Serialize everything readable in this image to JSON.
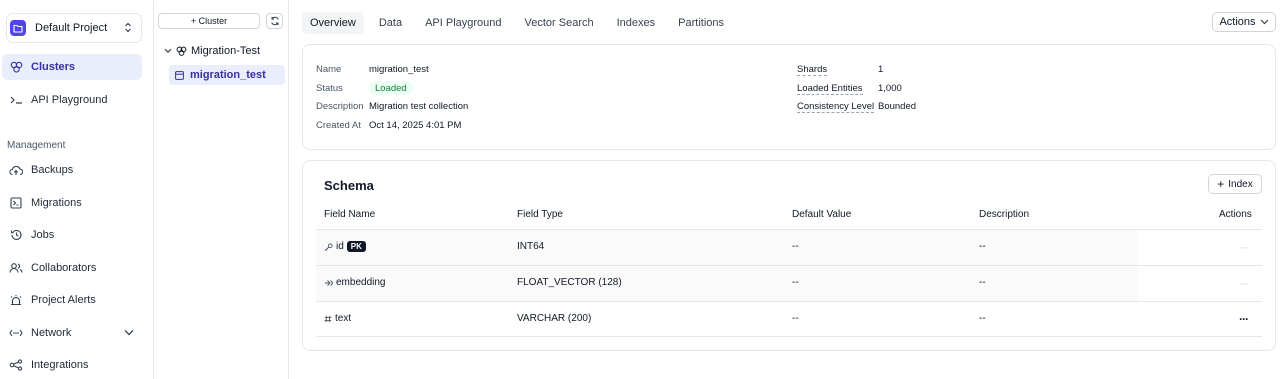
{
  "project": {
    "name": "Default Project"
  },
  "sidebar": {
    "items": [
      {
        "label": "Clusters"
      },
      {
        "label": "API Playground"
      }
    ],
    "section_label": "Management",
    "management_items": [
      {
        "label": "Backups"
      },
      {
        "label": "Migrations"
      },
      {
        "label": "Jobs"
      },
      {
        "label": "Collaborators"
      },
      {
        "label": "Project Alerts"
      },
      {
        "label": "Network"
      },
      {
        "label": "Integrations"
      }
    ]
  },
  "tree": {
    "add_cluster_label": "+ Cluster",
    "cluster_name": "Migration-Test",
    "collection_name": "migration_test"
  },
  "tabs": [
    {
      "label": "Overview"
    },
    {
      "label": "Data"
    },
    {
      "label": "API Playground"
    },
    {
      "label": "Vector Search"
    },
    {
      "label": "Indexes"
    },
    {
      "label": "Partitions"
    }
  ],
  "actions_label": "Actions",
  "overview": {
    "name_label": "Name",
    "name_value": "migration_test",
    "status_label": "Status",
    "status_value": "Loaded",
    "description_label": "Description",
    "description_value": "Migration test collection",
    "created_label": "Created At",
    "created_value": "Oct 14, 2025 4:01 PM",
    "shards_label": "Shards",
    "shards_value": "1",
    "entities_label": "Loaded Entities",
    "entities_value": "1,000",
    "consistency_label": "Consistency Level",
    "consistency_value": "Bounded"
  },
  "schema": {
    "title": "Schema",
    "index_button": "Index",
    "headers": {
      "field_name": "Field Name",
      "field_type": "Field Type",
      "default_value": "Default Value",
      "description": "Description",
      "actions": "Actions"
    },
    "rows": [
      {
        "name": "id",
        "badge": "PK",
        "type": "INT64",
        "default": "--",
        "description": "--"
      },
      {
        "name": "embedding",
        "type": "FLOAT_VECTOR (128)",
        "default": "--",
        "description": "--"
      },
      {
        "name": "text",
        "type": "VARCHAR (200)",
        "default": "--",
        "description": "--"
      }
    ]
  },
  "colors": {
    "accent": "#4f46e5",
    "active_bg": "#eaeefc",
    "status_green": "#15803d"
  }
}
